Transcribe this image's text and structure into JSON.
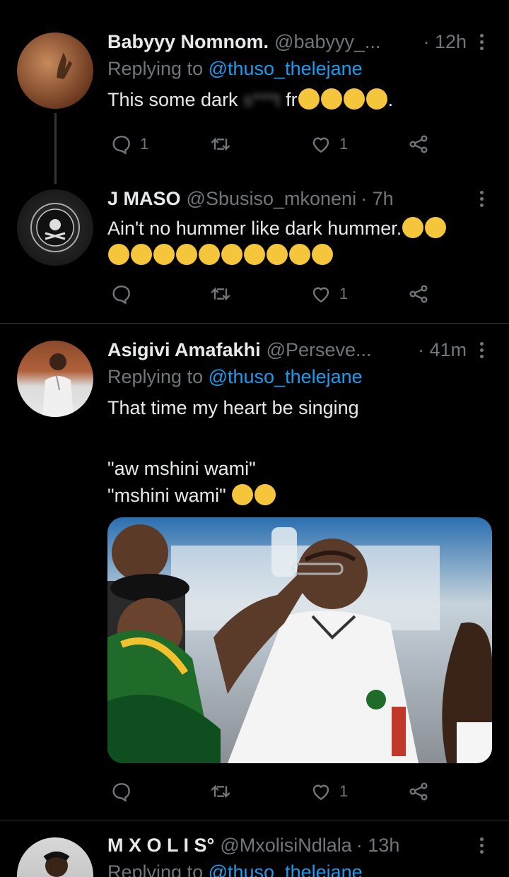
{
  "tweets": [
    {
      "name": "Babyyy Nomnom.",
      "handle": "@babyyy_...",
      "time": "· 12h",
      "reply_prefix": "Replying to ",
      "reply_mention": "@thuso_thelejane",
      "text_before": "This some dark",
      "text_censored": "s***t",
      "text_after": " fr",
      "text_end": ".",
      "counts": {
        "reply": "1",
        "retweet": "",
        "like": "1"
      }
    },
    {
      "name": "J MASO",
      "handle": "@Sbusiso_mkoneni",
      "time": "· 7h",
      "text_line1": "Ain't no hummer like dark hummer.",
      "counts": {
        "reply": "",
        "retweet": "",
        "like": "1"
      }
    },
    {
      "name": "Asigivi Amafakhi",
      "handle": "@Perseve...",
      "time": "· 41m",
      "reply_prefix": "Replying to ",
      "reply_mention": "@thuso_thelejane",
      "text_line1": "That time my heart be singing",
      "text_line2": "\"aw mshini wami\"",
      "text_line3": "\"mshini wami\"",
      "counts": {
        "reply": "",
        "retweet": "",
        "like": "1"
      }
    },
    {
      "name": "M X O L I S°",
      "handle": "@MxolisiNdlala",
      "time": "· 13h",
      "reply_prefix": "Replying to ",
      "reply_mention": "@thuso_thelejane"
    }
  ],
  "icons": [
    "reply-icon",
    "retweet-icon",
    "like-icon",
    "share-icon",
    "more-icon"
  ],
  "colors": {
    "background": "#000000",
    "text": "#e7e9ea",
    "muted": "#71767b",
    "link": "#1d9bf0",
    "divider": "#2f3336"
  }
}
